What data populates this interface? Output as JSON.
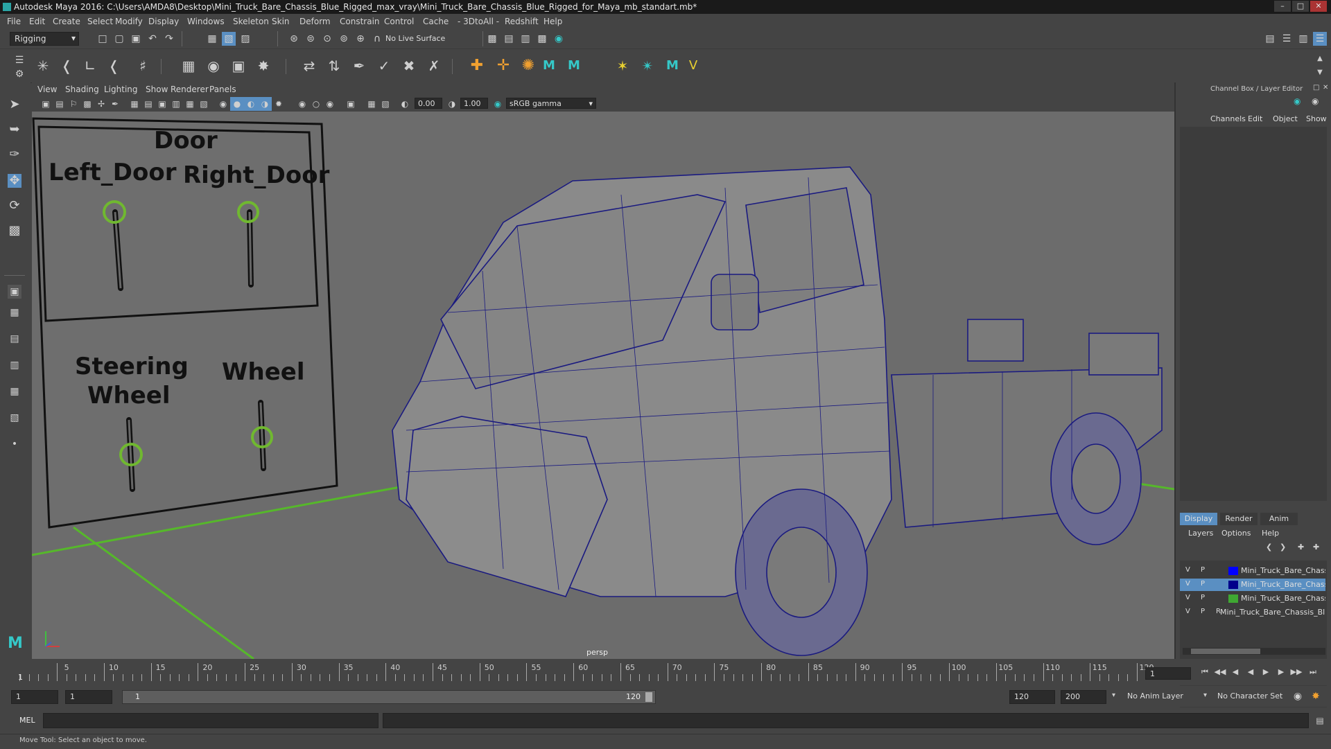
{
  "app": {
    "title": "Autodesk Maya 2016: C:\\Users\\AMDA8\\Desktop\\Mini_Truck_Bare_Chassis_Blue_Rigged_max_vray\\Mini_Truck_Bare_Chassis_Blue_Rigged_for_Maya_mb_standart.mb*"
  },
  "menu": [
    "File",
    "Edit",
    "Create",
    "Select",
    "Modify",
    "Display",
    "Windows",
    "Skeleton",
    "Skin",
    "Deform",
    "Constrain",
    "Control",
    "Cache",
    "- 3DtoAll -",
    "Redshift",
    "Help"
  ],
  "toolbar": {
    "mode": "Rigging",
    "live_surface": "No Live Surface"
  },
  "viewport": {
    "menu": [
      "View",
      "Shading",
      "Lighting",
      "Show",
      "Renderer",
      "Panels"
    ],
    "exposure": "0.00",
    "gamma": "1.00",
    "color_space": "sRGB gamma",
    "camera": "persp",
    "controls": {
      "door_title": "Door",
      "left_door": "Left_Door",
      "right_door": "Right_Door",
      "steering_line1": "Steering",
      "steering_line2": "Wheel",
      "wheel": "Wheel"
    }
  },
  "channel_box": {
    "title": "Channel Box / Layer Editor",
    "tabs": [
      "Channels",
      "Edit",
      "Object",
      "Show"
    ]
  },
  "layer_editor": {
    "tabs": [
      "Display",
      "Render",
      "Anim"
    ],
    "menu": [
      "Layers",
      "Options",
      "Help"
    ],
    "layers": [
      {
        "v": "V",
        "p": "P",
        "r": "",
        "name": "Mini_Truck_Bare_Chassis",
        "color": "#0000ff"
      },
      {
        "v": "V",
        "p": "P",
        "r": "",
        "name": "Mini_Truck_Bare_Chassis",
        "color": "#00008b"
      },
      {
        "v": "V",
        "p": "P",
        "r": "",
        "name": "Mini_Truck_Bare_Chassis",
        "color": "#3fa832"
      },
      {
        "v": "V",
        "p": "P",
        "r": "R",
        "name": "Mini_Truck_Bare_Chassis_Blu",
        "color": ""
      }
    ]
  },
  "timeline": {
    "ticks": [
      "5",
      "10",
      "15",
      "20",
      "25",
      "30",
      "35",
      "40",
      "45",
      "50",
      "55",
      "60",
      "65",
      "70",
      "75",
      "80",
      "85",
      "90",
      "95",
      "100",
      "105",
      "110",
      "115",
      "120"
    ],
    "start_marker": "1",
    "current_frame": "1"
  },
  "range": {
    "start": "1",
    "playback_start": "1",
    "slider_start": "1",
    "slider_end": "120",
    "playback_end": "120",
    "end": "200",
    "anim_layer": "No Anim Layer",
    "character_set": "No Character Set"
  },
  "command_line": {
    "label": "MEL"
  },
  "help_line": "Move Tool: Select an object to move."
}
